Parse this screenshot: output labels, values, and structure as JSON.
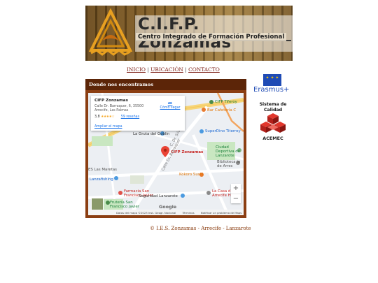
{
  "banner": {
    "title": "C.I.F.P. Zonzamas",
    "subtitle": "Centro Integrado de Formación Profesional"
  },
  "nav": {
    "items": [
      "INICIO",
      "UBICACIÓN",
      "CONTACTO"
    ],
    "separator": "|"
  },
  "panel": {
    "heading": "Donde nos encontramos"
  },
  "map": {
    "place_name": "CIFP Zonzamas",
    "address": "Calle Dr. Barraquer, 6, 35500 Arrecife, Las Palmas",
    "rating": "3,8",
    "stars": "★★★★☆",
    "reviews_link": "59 reseñas",
    "enlarge_link": "Ampliar el mapa",
    "directions_label": "Cómo llegar",
    "pin_label": "CIFP Zonzamas",
    "labels": {
      "tiferoy": "CIFP Tiferoy",
      "bar": "Bar Cafetería C",
      "goblin": "La Gruta del Goblin",
      "superdino": "SuperDino Titerroy",
      "ciudad": "Ciudad Deportiva de Lanzarote",
      "biblioteca": "Biblioteca in de Arrec",
      "masteras": "ES Las Maretas",
      "lanzafishing": "Lanzafishing",
      "farmacia": "Farmacia San Francisco Javier",
      "kokoro": "Kokoro Sushi",
      "casa": "La Casa d Arrecife Host",
      "seguridad": "Seguridad Lanzarote",
      "fruteria": "Frutería San Francisco Javier",
      "street1": "Calle Dr. Barraquer",
      "street2": "C. Dr. Silva"
    },
    "zoom_in": "+",
    "zoom_out": "−",
    "google_logo": "Google",
    "attribution": "Datos del mapa ©2023 Inst. Geogr. Nacional",
    "terms": "Términos",
    "report": "Notificar un problema de Maps"
  },
  "sidebar": {
    "erasmus_label": "Erasmus+",
    "quality_title": "Sistema de Calidad",
    "acemec_label": "ACEMEC"
  },
  "footer": {
    "copyright": "© I.E.S. Zonzamas - Arrecife - Lanzarote"
  },
  "colors": {
    "brand_brown": "#8b3e12",
    "heading_dark": "#5c2508",
    "link_red": "#7a1a10",
    "erasmus_blue": "#1f4bb5",
    "pin_red": "#ea4335"
  }
}
